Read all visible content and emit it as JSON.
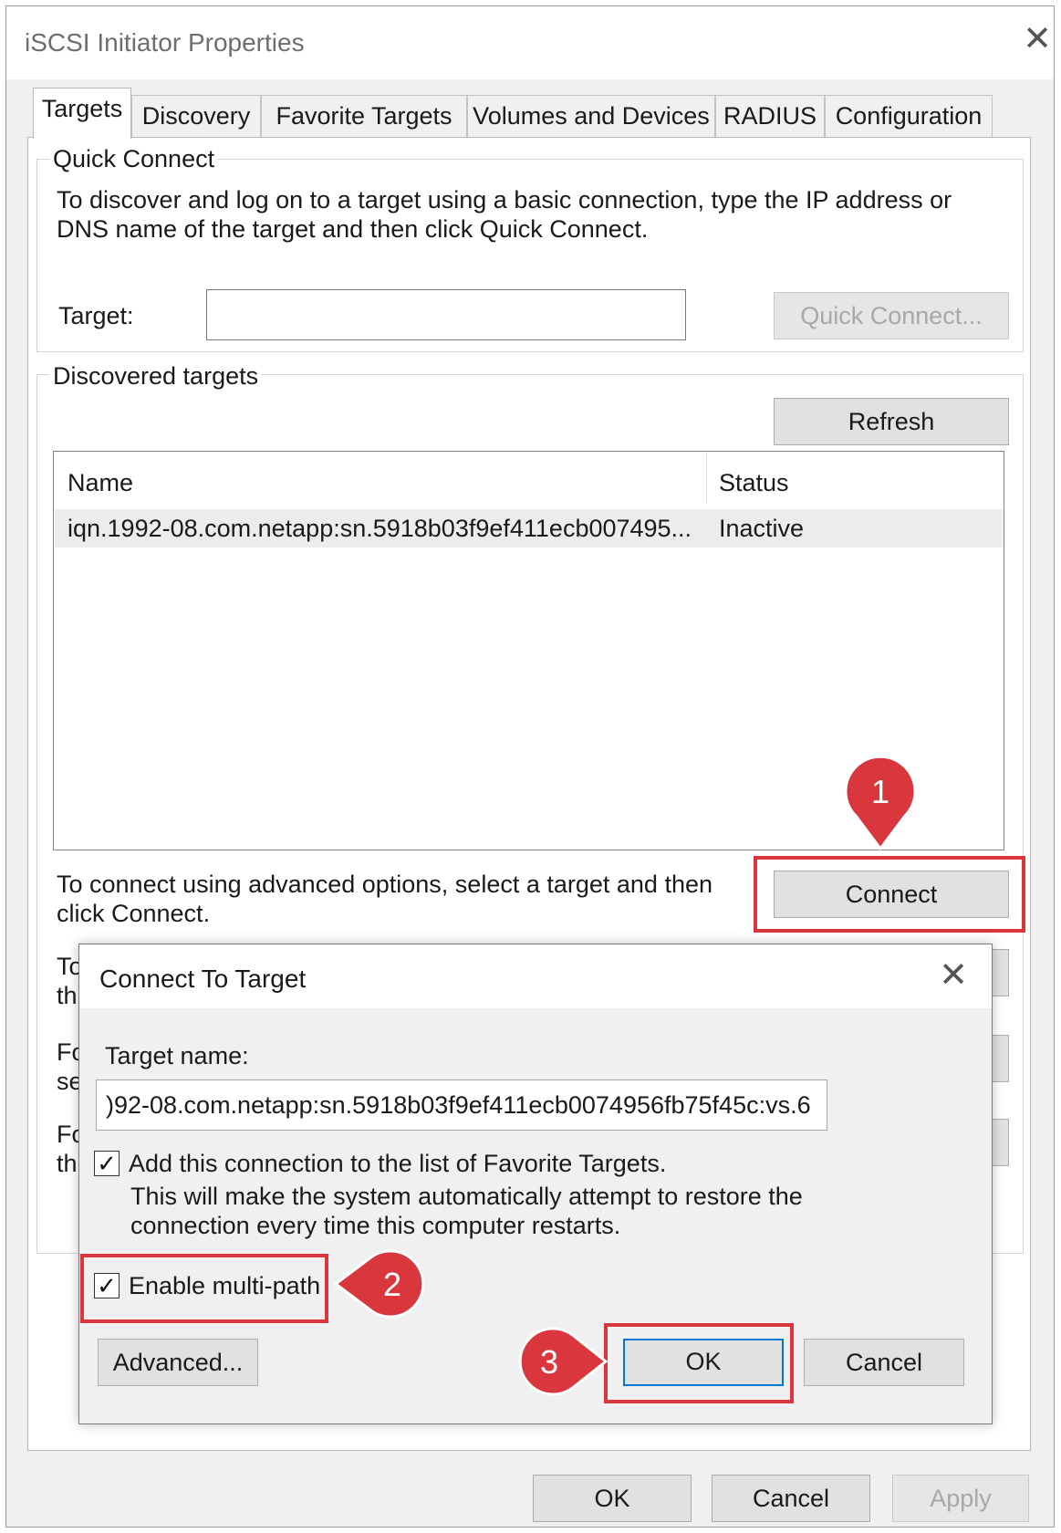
{
  "window": {
    "title": "iSCSI Initiator Properties",
    "close_glyph": "✕"
  },
  "tabs": [
    {
      "label": "Targets"
    },
    {
      "label": "Discovery"
    },
    {
      "label": "Favorite Targets"
    },
    {
      "label": "Volumes and Devices"
    },
    {
      "label": "RADIUS"
    },
    {
      "label": "Configuration"
    }
  ],
  "quick_connect": {
    "legend": "Quick Connect",
    "desc_line1": "To discover and log on to a target using a basic connection, type the IP address or",
    "desc_line2": "DNS name of the target and then click Quick Connect.",
    "target_label": "Target:",
    "target_value": "",
    "button": "Quick Connect..."
  },
  "discovered": {
    "legend": "Discovered targets",
    "refresh_button": "Refresh",
    "columns": {
      "name": "Name",
      "status": "Status"
    },
    "rows": [
      {
        "name": "iqn.1992-08.com.netapp:sn.5918b03f9ef411ecb007495...",
        "status": "Inactive"
      }
    ],
    "connect_desc_line1": "To connect using advanced options, select a target and then",
    "connect_desc_line2": "click Connect.",
    "connect_button": "Connect",
    "hidden_text_1a": "To",
    "hidden_text_1b": "th",
    "hidden_text_2a": "Fo",
    "hidden_text_2b": "se",
    "hidden_text_3a": "Fo",
    "hidden_text_3b": "th"
  },
  "dialog": {
    "title": "Connect To Target",
    "close_glyph": "✕",
    "target_name_label": "Target name:",
    "target_name_value": ")92-08.com.netapp:sn.5918b03f9ef411ecb0074956fb75f45c:vs.6",
    "favorite_checkbox": {
      "checked": true,
      "glyph": "✓",
      "label": "Add this connection to the list of Favorite Targets.",
      "note_line1": "This will make the system automatically attempt to restore the",
      "note_line2": "connection every time this computer restarts."
    },
    "multipath_checkbox": {
      "checked": true,
      "glyph": "✓",
      "label": "Enable multi-path"
    },
    "advanced_button": "Advanced...",
    "ok_button": "OK",
    "cancel_button": "Cancel"
  },
  "footer": {
    "ok_button": "OK",
    "cancel_button": "Cancel",
    "apply_button": "Apply"
  },
  "annotations": {
    "badge_1": "1",
    "badge_2": "2",
    "badge_3": "3",
    "highlight_color": "#d9363e",
    "badge_color": "#d9363e"
  }
}
